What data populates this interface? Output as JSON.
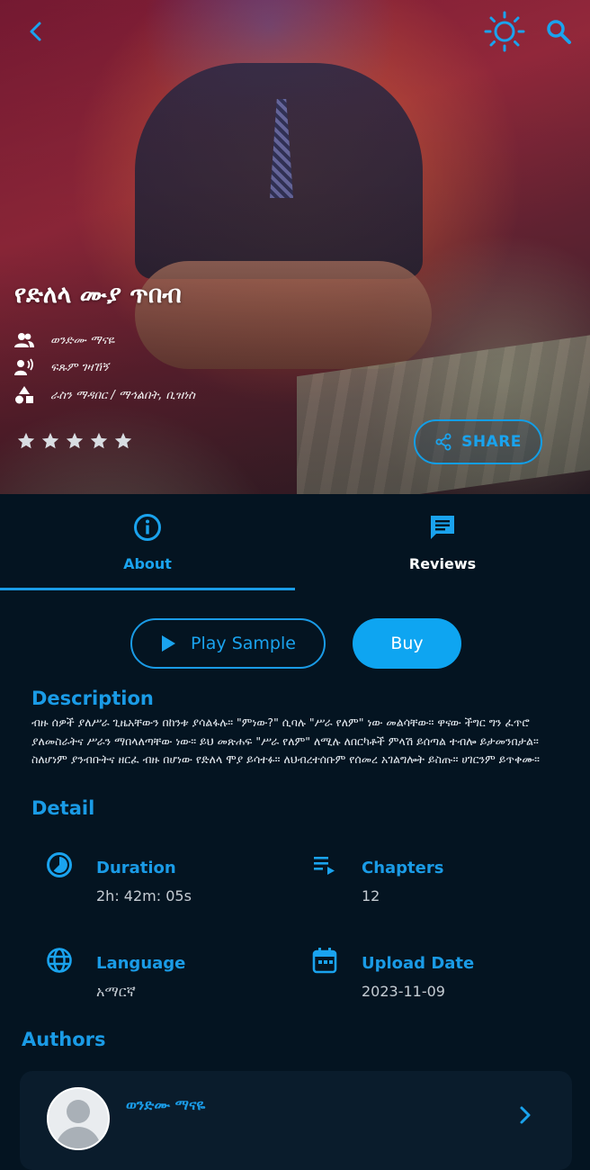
{
  "header": {
    "back_icon": "chevron-left-icon",
    "theme_icon": "sun-icon",
    "search_icon": "search-icon"
  },
  "book": {
    "title": "የድለላ ሙያ ጥበብ",
    "author": "ወንድሙ ማናዬ",
    "narrator": "ፍጹም ገዛኸኝ",
    "categories": "ራስን ማዳበር / ማኅልበት, ቢዝነስ",
    "rating": 5,
    "share_label": "SHARE"
  },
  "tabs": [
    {
      "label": "About",
      "icon": "info-icon",
      "active": true
    },
    {
      "label": "Reviews",
      "icon": "chat-icon",
      "active": false
    }
  ],
  "actions": {
    "sample_label": "Play Sample",
    "buy_label": "Buy"
  },
  "description": {
    "heading": "Description",
    "text": "ብዙ ሰዎች ያለሥራ ጊዜአቸውን በከንቱ ያሳልፋሉ። \"ምነው?\" ሲባሉ \"ሥራ የለም\" ነው መልሳቸው። ዋናው ችግር ግን ፈጥሮ ያለመስራትና ሥራን ማበላለጣቸው ነው። ይህ መጽሐፍ \"ሥራ የለም\" ለሚሉ ለበርካቶች ምላሽ ይሰጣል ተብሎ ይታመንበታል። ስለሆነም ያንብቡትና ዘርፈ ብዙ በሆነው የድለላ ሞያ ይሳተፉ። ለህብረተሰቡም የሰመረ አገልግሎት ይስጡ። ሀገርንም ይጥቀሙ።"
  },
  "detail": {
    "heading": "Detail",
    "items": [
      {
        "label": "Duration",
        "value": "2h: 42m: 05s",
        "icon": "timer-icon"
      },
      {
        "label": "Chapters",
        "value": "12",
        "icon": "playlist-icon"
      },
      {
        "label": "Language",
        "value": "አማርኛ",
        "icon": "globe-icon"
      },
      {
        "label": "Upload Date",
        "value": "2023-11-09",
        "icon": "calendar-icon"
      }
    ]
  },
  "authors": {
    "heading": "Authors",
    "list": [
      {
        "name": "ወንድሙ ማናዬ"
      }
    ]
  },
  "colors": {
    "accent": "#1a9be6",
    "background": "#041421",
    "buy": "#0ea5f1",
    "card": "#0a1c2c"
  }
}
